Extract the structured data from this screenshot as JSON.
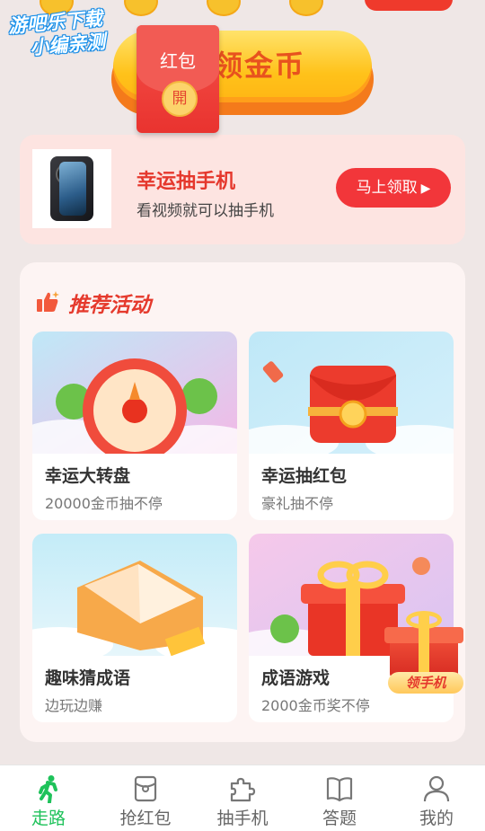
{
  "watermark": {
    "line1": "游吧乐下载",
    "line2": "小编亲测"
  },
  "gold_button": {
    "label": "领金币"
  },
  "red_packet": {
    "label": "红包",
    "seal": "開"
  },
  "promo": {
    "title": "幸运抽手机",
    "subtitle": "看视频就可以抽手机",
    "button": "马上领取",
    "arrow": "▶"
  },
  "activities": {
    "title": "推荐活动",
    "items": [
      {
        "name": "幸运大转盘",
        "desc": "20000金币抽不停"
      },
      {
        "name": "幸运抽红包",
        "desc": "豪礼抽不停"
      },
      {
        "name": "趣味猜成语",
        "desc": "边玩边赚"
      },
      {
        "name": "成语游戏",
        "desc": "2000金币奖不停"
      }
    ]
  },
  "corner_gift": {
    "tag": "领手机"
  },
  "tabs": [
    {
      "label": "走路",
      "icon": "walking-person-icon",
      "active": true
    },
    {
      "label": "抢红包",
      "icon": "red-packet-icon",
      "active": false
    },
    {
      "label": "抽手机",
      "icon": "puzzle-icon",
      "active": false
    },
    {
      "label": "答题",
      "icon": "book-icon",
      "active": false
    },
    {
      "label": "我的",
      "icon": "user-icon",
      "active": false
    }
  ],
  "colors": {
    "accent": "#e5382d",
    "tab_active": "#1ec25a",
    "gold": "#ffc21a"
  }
}
